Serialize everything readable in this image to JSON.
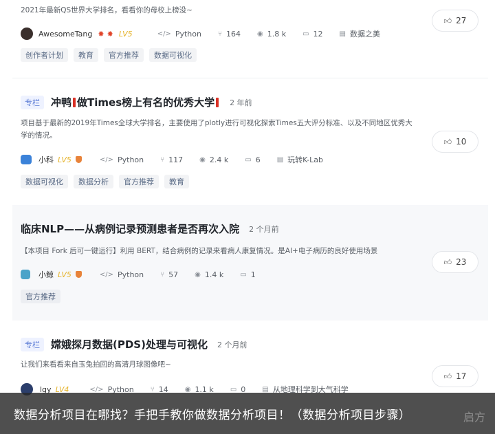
{
  "colors": {
    "accent": "#5b7bd5",
    "level": "#e5b32a",
    "overlay": "#282828"
  },
  "cards": [
    {
      "desc": "2021年最新QS世界大学排名，看看你的母校上榜没~",
      "author": "AwesomeTang",
      "level": "LV5",
      "language": "Python",
      "forks": "164",
      "views": "1.8 k",
      "comments": "12",
      "project": "数据之美",
      "tags": [
        "创作者计划",
        "教育",
        "官方推荐",
        "数据可视化"
      ],
      "likes": "27"
    },
    {
      "column_tag": "专栏",
      "title_a": "冲鸭",
      "title_b": "做Times榜上有名的优秀大学",
      "time": "2 年前",
      "desc": "项目基于最新的2019年Times全球大学排名，主要使用了plotly进行可视化探索Times五大评分标准、以及不同地区优秀大学的情况。",
      "author": "小科",
      "level": "LV5",
      "language": "Python",
      "forks": "117",
      "views": "2.4 k",
      "comments": "6",
      "project": "玩转K-Lab",
      "tags": [
        "数据可视化",
        "数据分析",
        "官方推荐",
        "教育"
      ],
      "likes": "10"
    },
    {
      "title": "临床NLP——从病例记录预测患者是否再次入院",
      "time": "2 个月前",
      "desc": "【本项目 Fork 后可一键运行】利用 BERT，结合病例的记录来看病人康复情况。是AI+电子病历的良好使用场景",
      "author": "小鲸",
      "level": "LV5",
      "language": "Python",
      "forks": "57",
      "views": "1.4 k",
      "comments": "1",
      "tags": [
        "官方推荐"
      ],
      "likes": "23"
    },
    {
      "column_tag": "专栏",
      "title": "嫦娥探月数据(PDS)处理与可视化",
      "time": "2 个月前",
      "desc": "让我们来看看来自玉兔拍回的高清月球图像吧~",
      "author": "lgy",
      "level": "LV4",
      "language": "Python",
      "forks": "14",
      "views": "1.1 k",
      "comments": "0",
      "project": "从地理科学到大气科学",
      "likes": "17"
    }
  ],
  "overlay": {
    "text": "数据分析项目在哪找？手把手教你做数据分析项目！（数据分析项目步骤）",
    "brand": "启方"
  }
}
